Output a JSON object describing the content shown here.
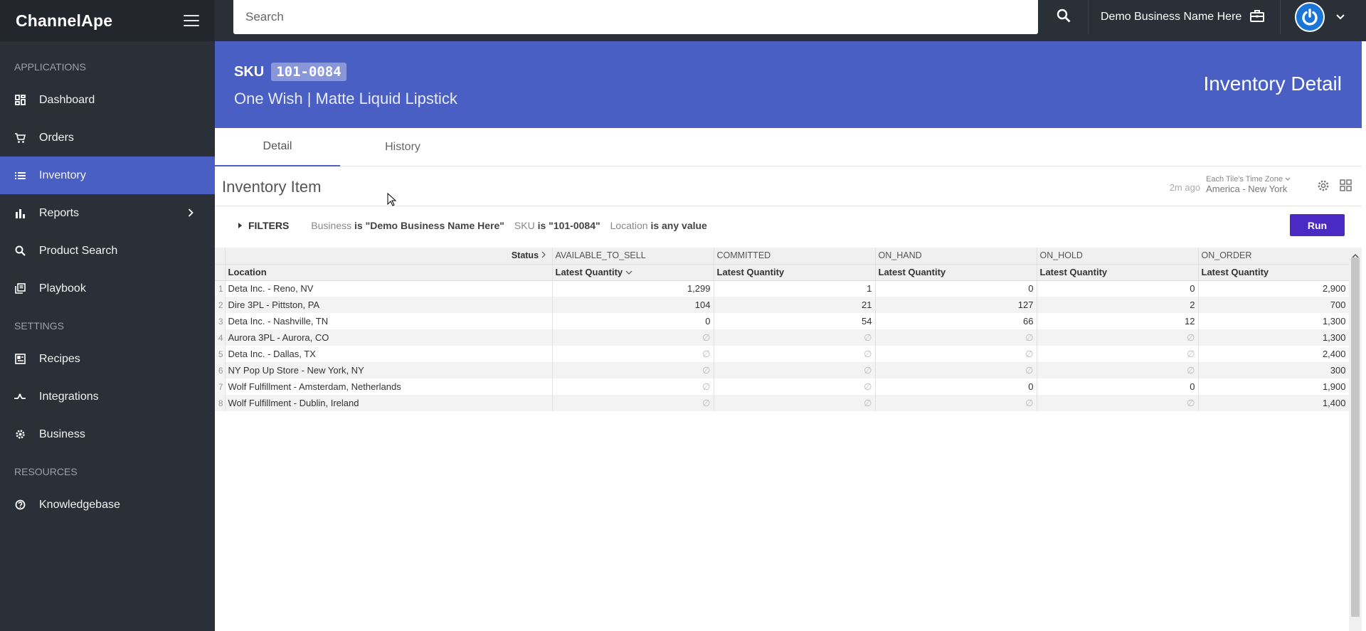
{
  "app": {
    "brand": "ChannelApe"
  },
  "sidebar": {
    "sections": [
      "APPLICATIONS",
      "SETTINGS",
      "RESOURCES"
    ],
    "items": [
      {
        "label": "Dashboard",
        "icon": "dashboard-icon"
      },
      {
        "label": "Orders",
        "icon": "cart-icon"
      },
      {
        "label": "Inventory",
        "icon": "list-icon",
        "active": true
      },
      {
        "label": "Reports",
        "icon": "bar-chart-icon",
        "has_submenu": true
      },
      {
        "label": "Product Search",
        "icon": "search-icon"
      },
      {
        "label": "Playbook",
        "icon": "book-icon"
      },
      {
        "label": "Recipes",
        "icon": "recipe-icon"
      },
      {
        "label": "Integrations",
        "icon": "integrations-icon"
      },
      {
        "label": "Business",
        "icon": "gear-icon"
      },
      {
        "label": "Knowledgebase",
        "icon": "help-icon"
      }
    ]
  },
  "topbar": {
    "search_placeholder": "Search",
    "business_name": "Demo Business Name Here"
  },
  "header": {
    "sku_label": "SKU",
    "sku_code": "101-0084",
    "product_name": "One Wish | Matte Liquid Lipstick",
    "page_title": "Inventory Detail"
  },
  "tabs": [
    {
      "label": "Detail",
      "active": true
    },
    {
      "label": "History",
      "active": false
    }
  ],
  "tile": {
    "title": "Inventory Item",
    "ago": "2m ago",
    "tz_label": "Each Tile's Time Zone",
    "tz": "America - New York"
  },
  "filters": {
    "toggle_label": "FILTERS",
    "items": [
      {
        "field": "Business",
        "cond": "is \"Demo Business Name Here\""
      },
      {
        "field": "SKU",
        "cond": "is \"101-0084\""
      },
      {
        "field": "Location",
        "cond": "is any value"
      }
    ],
    "run_label": "Run"
  },
  "table": {
    "status_label": "Status",
    "location_header": "Location",
    "measure_label": "Latest Quantity",
    "pivots": [
      "AVAILABLE_TO_SELL",
      "COMMITTED",
      "ON_HAND",
      "ON_HOLD",
      "ON_ORDER"
    ],
    "null_symbol": "∅",
    "rows": [
      {
        "n": "1",
        "location": "Deta Inc. - Reno, NV",
        "values": [
          "1,299",
          "1",
          "0",
          "0",
          "2,900"
        ]
      },
      {
        "n": "2",
        "location": "Dire 3PL - Pittston, PA",
        "values": [
          "104",
          "21",
          "127",
          "2",
          "700"
        ]
      },
      {
        "n": "3",
        "location": "Deta Inc. - Nashville, TN",
        "values": [
          "0",
          "54",
          "66",
          "12",
          "1,300"
        ]
      },
      {
        "n": "4",
        "location": "Aurora 3PL - Aurora, CO",
        "values": [
          null,
          null,
          null,
          null,
          "1,300"
        ]
      },
      {
        "n": "5",
        "location": "Deta Inc. - Dallas, TX",
        "values": [
          null,
          null,
          null,
          null,
          "2,400"
        ]
      },
      {
        "n": "6",
        "location": "NY Pop Up Store - New York, NY",
        "values": [
          null,
          null,
          null,
          null,
          "300"
        ]
      },
      {
        "n": "7",
        "location": "Wolf Fulfillment - Amsterdam, Netherlands",
        "values": [
          null,
          null,
          "0",
          "0",
          "1,900"
        ]
      },
      {
        "n": "8",
        "location": "Wolf Fulfillment - Dublin, Ireland",
        "values": [
          null,
          null,
          null,
          null,
          "1,400"
        ]
      }
    ]
  },
  "colors": {
    "accent": "#4a5fc4",
    "sidebar": "#2b2f38",
    "run": "#4b2ac4"
  }
}
